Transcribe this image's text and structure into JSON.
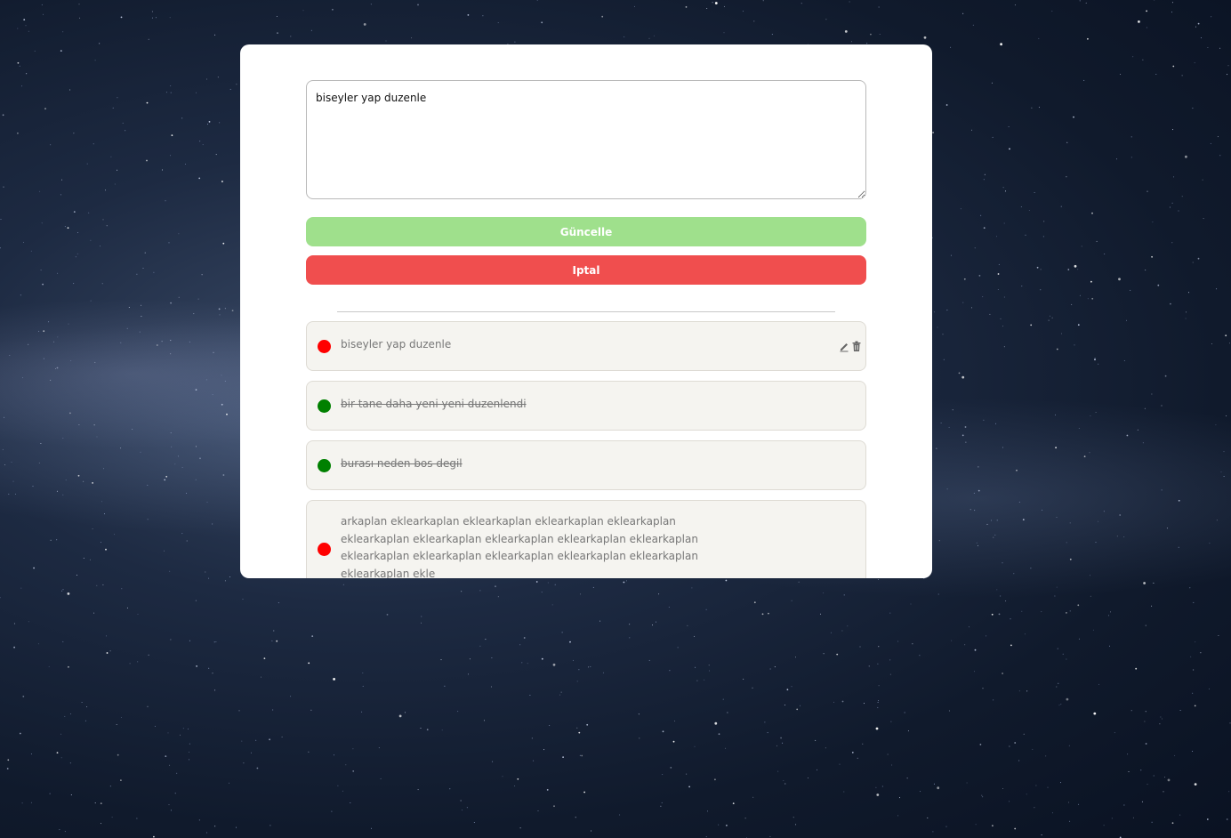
{
  "editor": {
    "value": "biseyler yap duzenle"
  },
  "buttons": {
    "update_label": "Güncelle",
    "cancel_label": "Iptal",
    "update_color": "#9fe08c",
    "cancel_color": "#f04e4e"
  },
  "todos": [
    {
      "text": "biseyler yap duzenle",
      "status": "pending",
      "status_color": "#ff0000",
      "editing": true,
      "actions": [
        "edit-icon",
        "trash-icon"
      ]
    },
    {
      "text": "bir tane daha yeni yeni duzenlendi",
      "status": "done",
      "status_color": "#008000"
    },
    {
      "text": "burası neden bos degil",
      "status": "done",
      "status_color": "#008000"
    },
    {
      "text": "arkaplan eklearkaplan eklearkaplan eklearkaplan eklearkaplan eklearkaplan eklearkaplan eklearkaplan eklearkaplan eklearkaplan eklearkaplan eklearkaplan eklearkaplan eklearkaplan eklearkaplan eklearkaplan ekle",
      "status": "pending",
      "status_color": "#ff0000"
    }
  ]
}
